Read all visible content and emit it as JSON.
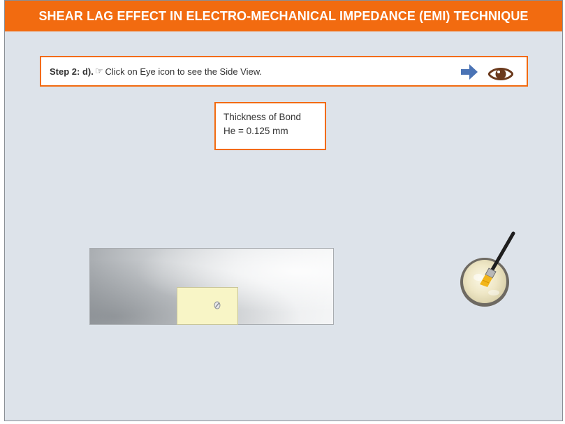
{
  "header": {
    "title": "SHEAR LAG EFFECT IN ELECTRO-MECHANICAL IMPEDANCE (EMI) TECHNIQUE"
  },
  "instruction": {
    "step_label": "Step 2: d).",
    "hand_icon": "☞",
    "text": "Click on Eye icon to see the Side View."
  },
  "controls": {
    "next_icon": "right-arrow-icon",
    "eye_icon": "eye-icon"
  },
  "thickness_info": {
    "title": "Thickness of Bond",
    "value": "He = 0.125 mm"
  },
  "colors": {
    "accent": "#f26b10",
    "background": "#dde3ea",
    "arrow": "#4a73b5",
    "eye": "#6b3a1d",
    "pzt_patch": "#f8f5c6"
  }
}
